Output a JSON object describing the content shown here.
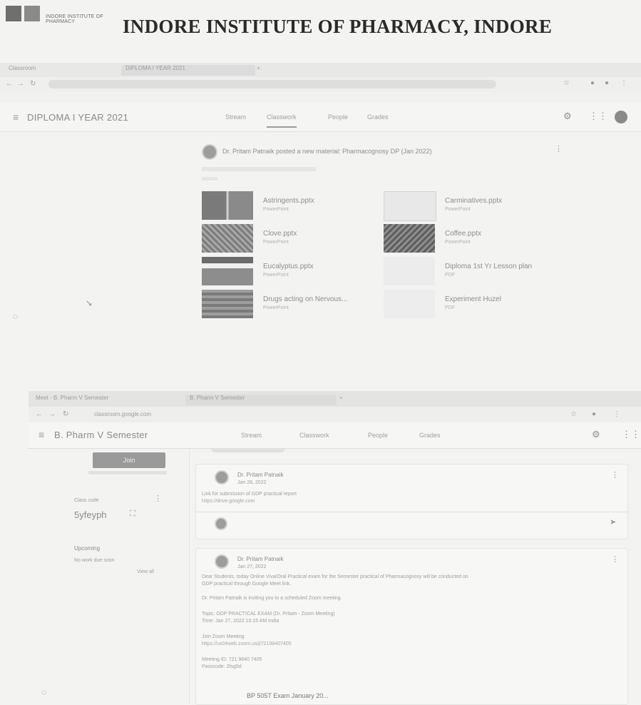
{
  "header": {
    "logo_text": "INDORE INSTITUTE OF PHARMACY",
    "title": "INDORE INSTITUTE OF PHARMACY, INDORE"
  },
  "shot1": {
    "tabs": [
      "Classroom",
      "DIPLOMA I YEAR 2021"
    ],
    "class_title": "DIPLOMA I YEAR 2021",
    "class_tabs": [
      "Stream",
      "Classwork",
      "People",
      "Grades"
    ],
    "post_text": "Dr. Pritam Patnaik posted a new material: Pharmacognosy DP (Jan 2022)",
    "attachments": [
      {
        "name": "Astringents.pptx",
        "type": "PowerPoint"
      },
      {
        "name": "Carminatives.pptx",
        "type": "PowerPoint"
      },
      {
        "name": "Clove.pptx",
        "type": "PowerPoint"
      },
      {
        "name": "Coffee.pptx",
        "type": "PowerPoint"
      },
      {
        "name": "Eucalyptus.pptx",
        "type": "PowerPoint"
      },
      {
        "name": "Diploma 1st Yr Lesson plan",
        "type": "PDF"
      },
      {
        "name": "Drugs acting on Nervous...",
        "type": "PowerPoint"
      },
      {
        "name": "Experiment Huzel",
        "type": "PDF"
      }
    ]
  },
  "shot2": {
    "tabs": [
      "Meet - B. Pharm V Semester",
      "B. Pharm V Semester"
    ],
    "url": "classroom.google.com",
    "class_title": "B. Pharm V Semester",
    "class_tabs": [
      "Stream",
      "Classwork",
      "People",
      "Grades"
    ],
    "join_label": "Join",
    "class_code_label": "Class code",
    "class_code_value": "5yfeyph",
    "upcoming_label": "Upcoming",
    "upcoming_note": "No work due soon",
    "view_all": "View all",
    "posts": [
      {
        "author": "Dr. Pritam Patnaik",
        "date": "Jan 28, 2022",
        "lines": [
          "Link for submission of GDP practical report"
        ],
        "link": "https://drive.google.com"
      },
      {
        "author": "Dr. Pritam Patnaik",
        "date": "Jan 27, 2022",
        "lines": [
          "Dear Students, today Online Viva/Oral Practical exam for the Semester practical of Pharmacognosy will be conducted on",
          "GDP practical through Google Meet link.",
          "Dr. Pritam Patnaik is inviting you to a scheduled Zoom meeting.",
          "Topic: GDP PRACTICAL EXAM (Dr. Pritam - Zoom Meeting)",
          "Time: Jan 27, 2022 10:15 AM India",
          "Join Zoom Meeting",
          "Meeting ID: 721 9840 7405",
          "Passcode: 2fsg5d"
        ],
        "link": "https://us04web.zoom.us/j/72198407405"
      }
    ],
    "bottom_file": "BP 505T Exam January 20..."
  }
}
